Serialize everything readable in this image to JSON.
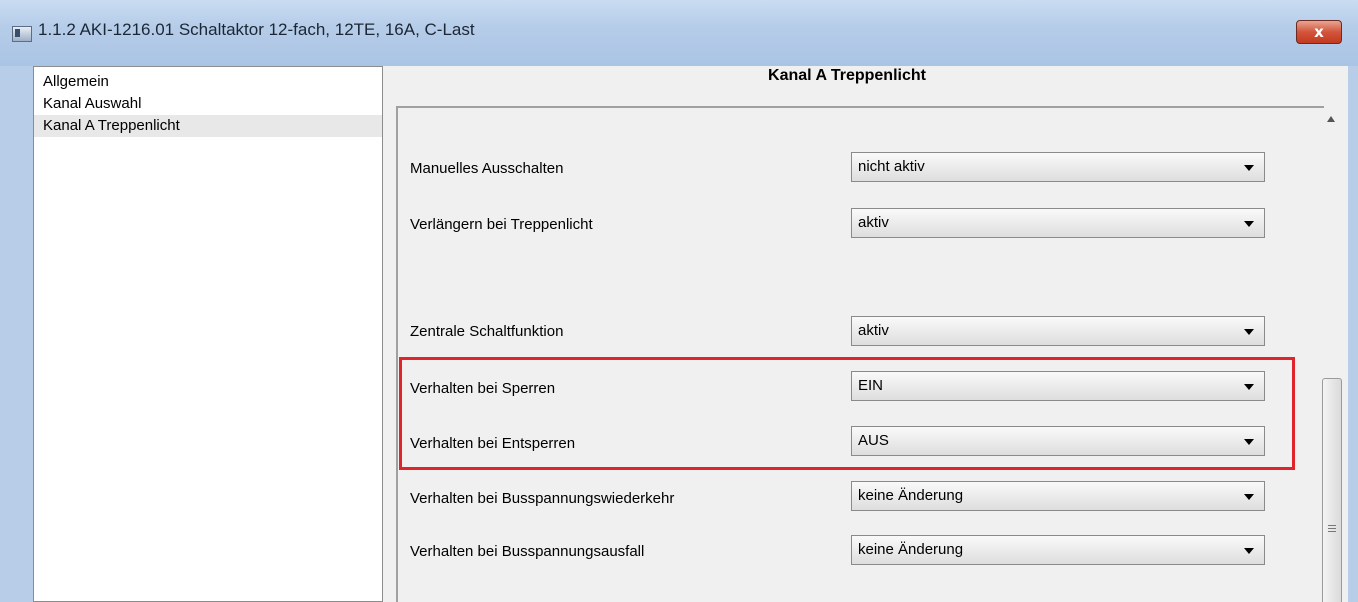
{
  "window": {
    "title": "1.1.2 AKI-1216.01 Schaltaktor 12-fach, 12TE, 16A, C-Last",
    "close_label": "x"
  },
  "tree": {
    "items": [
      {
        "label": "Allgemein",
        "selected": false
      },
      {
        "label": "Kanal Auswahl",
        "selected": false
      },
      {
        "label": "Kanal A Treppenlicht",
        "selected": true
      }
    ]
  },
  "panel": {
    "title": "Kanal A Treppenlicht",
    "params": [
      {
        "label": "Manuelles Ausschalten",
        "value": "nicht aktiv"
      },
      {
        "label": "Verlängern bei Treppenlicht",
        "value": "aktiv"
      },
      {
        "label": "Zentrale Schaltfunktion",
        "value": "aktiv"
      },
      {
        "label": "Verhalten bei Sperren",
        "value": "EIN"
      },
      {
        "label": "Verhalten bei Entsperren",
        "value": "AUS"
      },
      {
        "label": "Verhalten bei Busspannungswiederkehr",
        "value": "keine Änderung"
      },
      {
        "label": "Verhalten bei Busspannungsausfall",
        "value": "keine Änderung"
      }
    ]
  },
  "highlight_color": "#e0242b"
}
